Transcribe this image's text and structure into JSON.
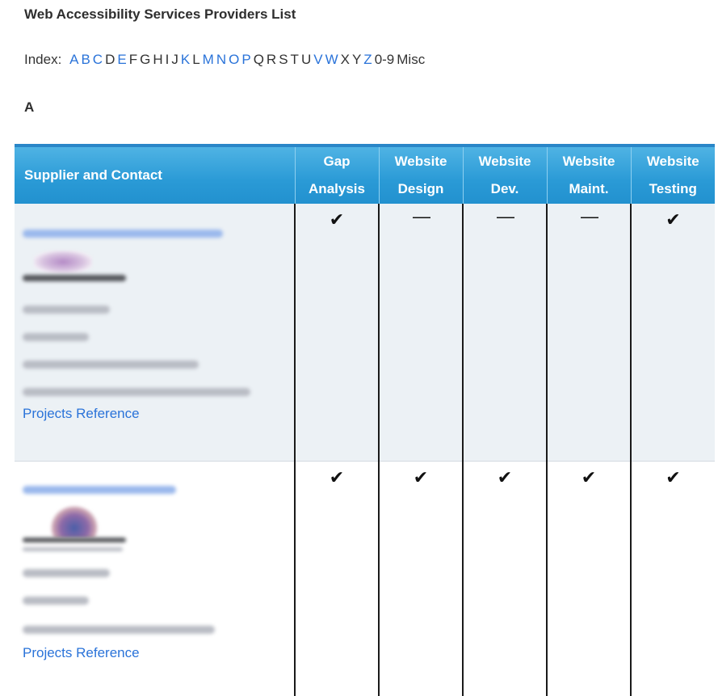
{
  "page": {
    "title": "Web Accessibility Services Providers List",
    "index_label": "Index:",
    "section_heading": "A"
  },
  "index_letters": [
    {
      "text": "A",
      "link": true
    },
    {
      "text": "B",
      "link": true
    },
    {
      "text": "C",
      "link": true
    },
    {
      "text": "D",
      "link": false
    },
    {
      "text": "E",
      "link": true
    },
    {
      "text": "F",
      "link": false
    },
    {
      "text": "G",
      "link": false
    },
    {
      "text": "H",
      "link": false
    },
    {
      "text": "I",
      "link": false
    },
    {
      "text": "J",
      "link": false
    },
    {
      "text": "K",
      "link": true
    },
    {
      "text": "L",
      "link": false
    },
    {
      "text": "M",
      "link": true
    },
    {
      "text": "N",
      "link": true
    },
    {
      "text": "O",
      "link": true
    },
    {
      "text": "P",
      "link": true
    },
    {
      "text": "Q",
      "link": false
    },
    {
      "text": "R",
      "link": false
    },
    {
      "text": "S",
      "link": false
    },
    {
      "text": "T",
      "link": false
    },
    {
      "text": "U",
      "link": false
    },
    {
      "text": "V",
      "link": true
    },
    {
      "text": "W",
      "link": true
    },
    {
      "text": "X",
      "link": false
    },
    {
      "text": "Y",
      "link": false
    },
    {
      "text": "Z",
      "link": true
    },
    {
      "text": "0-9",
      "link": false
    },
    {
      "text": "Misc",
      "link": false
    }
  ],
  "table": {
    "headers": [
      {
        "line1": "Supplier and Contact",
        "line2": ""
      },
      {
        "line1": "Gap",
        "line2": "Analysis"
      },
      {
        "line1": "Website",
        "line2": "Design"
      },
      {
        "line1": "Website",
        "line2": "Dev."
      },
      {
        "line1": "Website",
        "line2": "Maint."
      },
      {
        "line1": "Website",
        "line2": "Testing"
      }
    ],
    "rows": [
      {
        "reference_link": "Projects Reference",
        "cells": [
          "✔",
          "—",
          "—",
          "—",
          "✔"
        ]
      },
      {
        "reference_link": "Projects Reference",
        "cells": [
          "✔",
          "✔",
          "✔",
          "✔",
          "✔"
        ]
      }
    ]
  },
  "colors": {
    "link": "#2a73d9",
    "header_bg": "#2a9ad6",
    "row_alt_bg": "#ecf1f5"
  }
}
